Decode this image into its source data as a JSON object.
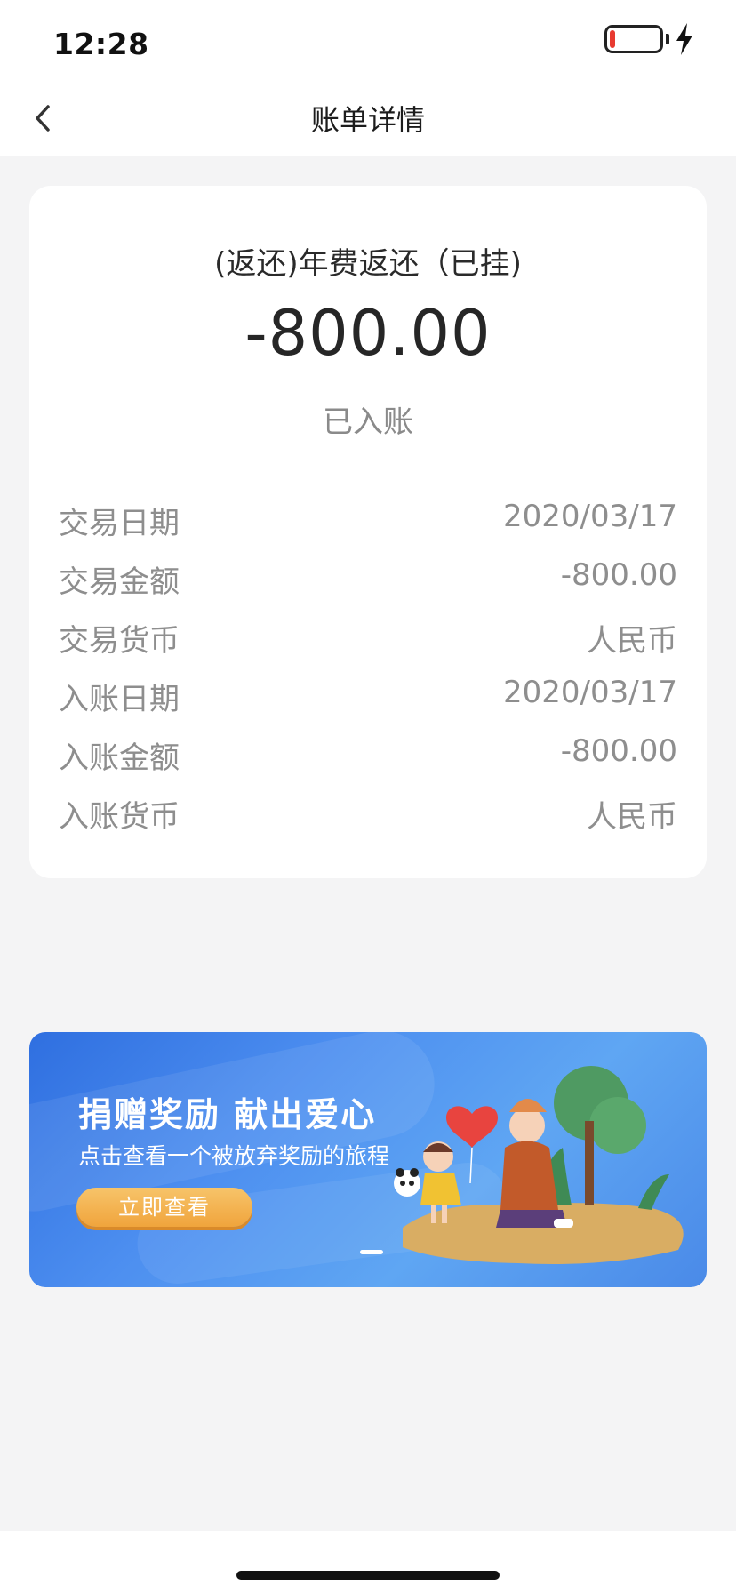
{
  "status_bar": {
    "time": "12:28",
    "icons": [
      "battery-low-icon",
      "charging-bolt-icon"
    ]
  },
  "navbar": {
    "title": "账单详情",
    "back_icon": "chevron-left-icon"
  },
  "bill": {
    "title": "(返还)年费返还（已挂)",
    "amount": "-800.00",
    "status": "已入账",
    "details": [
      {
        "label": "交易日期",
        "value": "2020/03/17"
      },
      {
        "label": "交易金额",
        "value": "-800.00"
      },
      {
        "label": "交易货币",
        "value": "人民币"
      },
      {
        "label": "入账日期",
        "value": "2020/03/17"
      },
      {
        "label": "入账金额",
        "value": "-800.00"
      },
      {
        "label": "入账货币",
        "value": "人民币"
      }
    ]
  },
  "banner": {
    "title": "捐赠奖励 献出爱心",
    "subtitle": "点击查看一个被放弃奖励的旅程",
    "button_label": "立即查看",
    "colors": {
      "background": "#4d8ff0",
      "button": "#f0a43c"
    }
  },
  "colors": {
    "battery_low": "#e83a30",
    "page_bg": "#f4f4f5"
  }
}
